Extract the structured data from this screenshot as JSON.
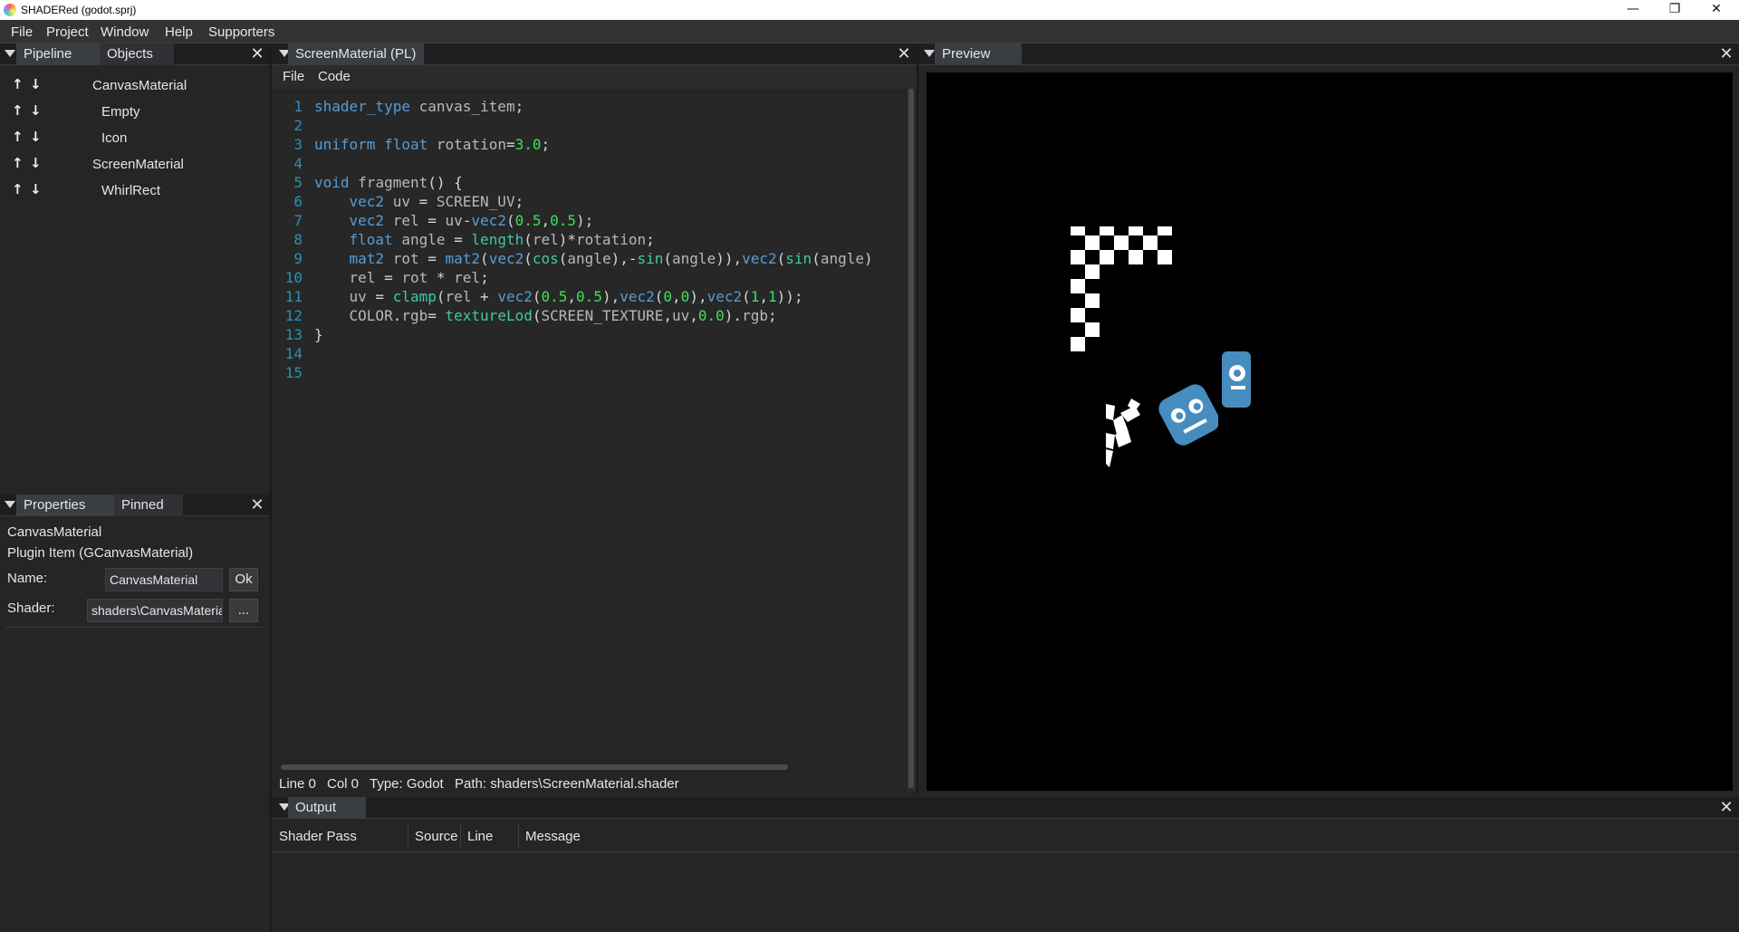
{
  "window": {
    "title": "SHADERed (godot.sprj)",
    "controls": {
      "minimize": "—",
      "restore": "❐",
      "close": "✕"
    }
  },
  "menubar": [
    "File",
    "Project",
    "Window",
    "Help",
    "Supporters"
  ],
  "pipeline_panel": {
    "tabs": [
      "Pipeline",
      "Objects"
    ],
    "items": [
      {
        "label": "CanvasMaterial",
        "indent": 0
      },
      {
        "label": "Empty",
        "indent": 1
      },
      {
        "label": "Icon",
        "indent": 1
      },
      {
        "label": "ScreenMaterial",
        "indent": 0
      },
      {
        "label": "WhirlRect",
        "indent": 1
      }
    ],
    "up_arrow": "🡅",
    "down_arrow": "🡇"
  },
  "properties_panel": {
    "tabs": [
      "Properties",
      "Pinned"
    ],
    "item_name": "CanvasMaterial",
    "item_type": "Plugin Item  (GCanvasMaterial)",
    "name_label": "Name:",
    "name_value": "CanvasMaterial",
    "ok_label": "Ok",
    "shader_label": "Shader:",
    "shader_value": "shaders\\CanvasMaterial.shader",
    "browse_label": "..."
  },
  "editor": {
    "tab": "ScreenMaterial (PL)",
    "menu": [
      "File",
      "Code"
    ],
    "line_numbers": [
      "1",
      "2",
      "3",
      "4",
      "5",
      "6",
      "7",
      "8",
      "9",
      "10",
      "11",
      "12",
      "13",
      "14",
      "15"
    ],
    "status": {
      "line": "Line 0",
      "col": "Col 0",
      "type": "Type: Godot",
      "path": "Path: shaders\\ScreenMaterial.shader"
    }
  },
  "preview": {
    "tab": "Preview"
  },
  "output": {
    "tab": "Output",
    "columns": [
      "Shader Pass",
      "Source",
      "Line",
      "Message"
    ]
  },
  "colors": {
    "keyword": "#569cd6",
    "number": "#3ee05a",
    "function": "#3ec9a8",
    "line_number": "#2b91af",
    "godot_icon": "#478cbf"
  }
}
